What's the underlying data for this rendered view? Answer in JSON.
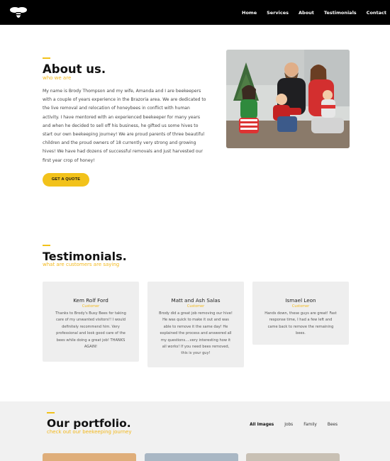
{
  "header": {
    "logo_icon": "bee-logo-icon",
    "nav": [
      "Home",
      "Services",
      "About",
      "Testimonials",
      "Contact"
    ]
  },
  "about": {
    "title": "About us.",
    "subtitle": "who we are",
    "body": "My name is Brody Thompson and my wife, Amanda and I are beekeepers with a couple of years experience in the Brazoria area. We are dedicated to the live removal and relocation of honeybees in conflict with human activity. I have mentored with an experienced beekeeper for many years and when he decided to sell off his business, he gifted us some hives to start our own beekeeping journey! We are proud parents of three beautiful children and the proud owners of 18 currently very strong and growing hives! We have had dozens of successful removals and just harvested our first year crop of honey!",
    "button": "GET A QUOTE"
  },
  "testimonials": {
    "title": "Testimonials.",
    "subtitle": "what are customers are saying",
    "cards": [
      {
        "name": "Kem Rolf Ford",
        "role": "Customer",
        "text": "Thanks to Brody's Busy Bees for taking care of my unwanted visitors!! I would definitely recommend him. Very professional and look good care of the bees while doing a great job! THANKS AGAIN!"
      },
      {
        "name": "Matt and Ash Salas",
        "role": "Customer",
        "text": "Brody did a great job removing our hive! He was quick to make it out and was able to remove it the same day! He explained the process and answered all my questions....very interesting how it all works! If you need bees removed, this is your guy!"
      },
      {
        "name": "Ismael Leon",
        "role": "Customer",
        "text": "Hands down, these guys are great! Fast response time, I had a few left and came back to remove the remaining bees."
      }
    ]
  },
  "portfolio": {
    "title": "Our portfolio.",
    "subtitle": "check out our beekeeping journey",
    "filters": [
      "All Images",
      "Jobs",
      "Family",
      "Bees"
    ]
  },
  "colors": {
    "accent": "#f2c21b",
    "header_bg": "#000000",
    "card_bg": "#eeeeee"
  }
}
